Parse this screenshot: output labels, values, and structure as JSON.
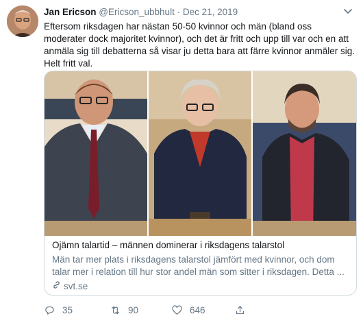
{
  "tweet": {
    "author_name": "Jan Ericson",
    "handle": "@Ericson_ubbhult",
    "separator": "·",
    "date": "Dec 21, 2019",
    "text": "Eftersom riksdagen har nästan 50-50 kvinnor och män (bland oss moderater dock majoritet kvinnor), och det är fritt och upp till var och en att anmäla sig till debatterna så visar ju detta bara att färre kvinnor anmäler sig. Helt fritt val.",
    "card": {
      "title": "Ojämn talartid – männen dominerar i riksdagens talarstol",
      "description": "Män tar mer plats i riksdagens talarstol jämfört med kvinnor, och dom talar mer i relation till hur stor andel män som sitter i riksdagen. Detta ...",
      "domain": "svt.se"
    },
    "actions": {
      "replies": "35",
      "retweets": "90",
      "likes": "646"
    }
  },
  "colors": {
    "text_primary": "#14171a",
    "text_secondary": "#657786",
    "card_border": "#cfd9de"
  }
}
